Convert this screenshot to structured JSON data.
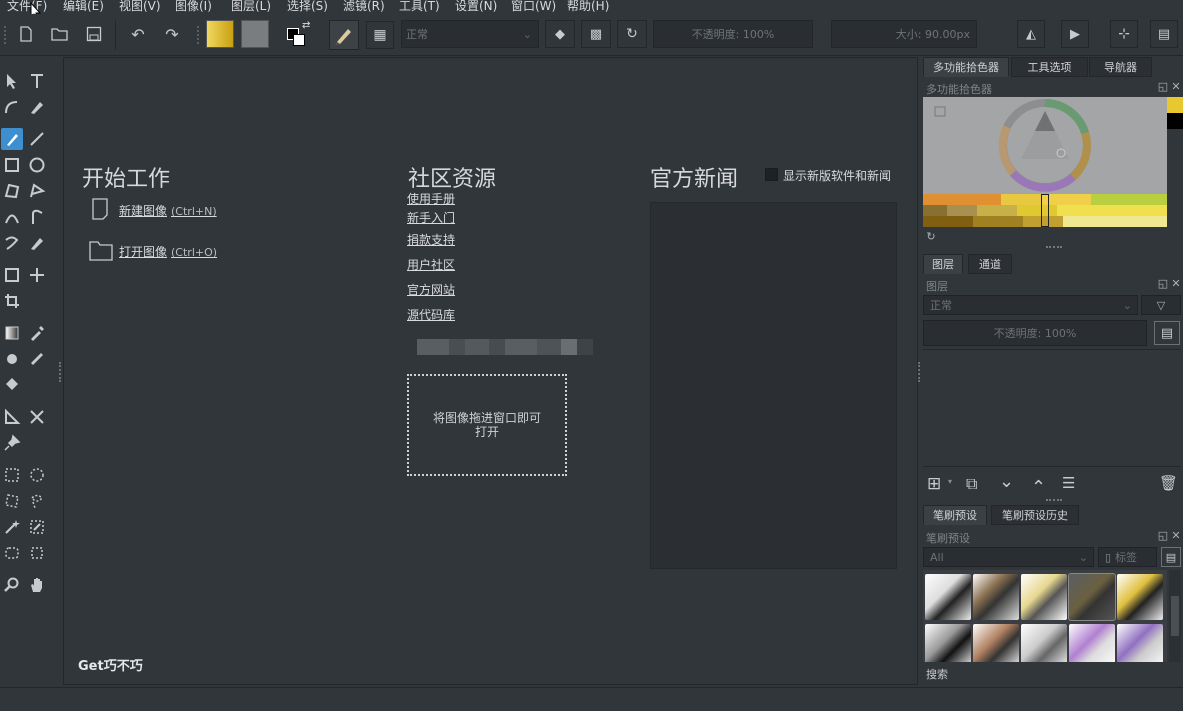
{
  "menubar": {
    "items": [
      "文件(F)",
      "编辑(E)",
      "视图(V)",
      "图像(I)",
      "图层(L)",
      "选择(S)",
      "滤镜(R)",
      "工具(T)",
      "设置(N)",
      "窗口(W)",
      "帮助(H)"
    ]
  },
  "toolbar": {
    "blend_mode": "正常",
    "opacity_label": "不透明度:",
    "opacity_value": "100%",
    "size_label": "大小:",
    "size_value": "90.00px"
  },
  "welcome": {
    "start": {
      "title": "开始工作",
      "new_image": "新建图像",
      "new_shortcut": "(Ctrl+N)",
      "open_image": "打开图像",
      "open_shortcut": "(Ctrl+O)"
    },
    "community": {
      "title": "社区资源",
      "links": [
        "使用手册",
        "新手入门",
        "捐款支持",
        "用户社区",
        "官方网站",
        "源代码库"
      ]
    },
    "news": {
      "title": "官方新闻",
      "checkbox_label": "显示新版软件和新闻"
    },
    "drop_zone": "将图像拖进窗口即可打开",
    "watermark": "Get巧不巧"
  },
  "dockers": {
    "top_tabs": [
      "多功能拾色器",
      "工具选项",
      "导航器"
    ],
    "color_selector_title": "多功能拾色器",
    "layer_tabs": [
      "图层",
      "通道"
    ],
    "layers_title": "图层",
    "layers_blend": "正常",
    "layers_opacity": "不透明度:  100%",
    "brush_tabs": [
      "笔刷预设",
      "笔刷预设历史"
    ],
    "brush_title": "笔刷预设",
    "brush_filter": "All",
    "brush_tag": "标签",
    "search_label": "搜索"
  },
  "colors": {
    "background": "#31363b",
    "panel_dark": "#2a2e32",
    "news_box": "#2b2f33",
    "accent_yellow": "#e8c840"
  }
}
